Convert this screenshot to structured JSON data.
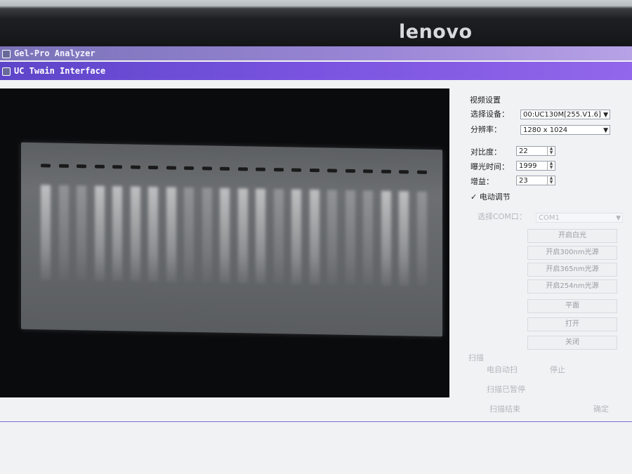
{
  "monitor": {
    "brand": "lenovo"
  },
  "app": {
    "title": "Gel-Pro Analyzer",
    "subtitle": "UC Twain Interface"
  },
  "panel": {
    "group_title": "视频设置",
    "device_label": "选择设备：",
    "device_value": "00:UC130M[255.V1.6]",
    "resolution_label": "分辨率：",
    "resolution_value": "1280 x 1024",
    "contrast_label": "对比度：",
    "contrast_value": "22",
    "exposure_label": "曝光时间：",
    "exposure_value": "1999",
    "gain_label": "增益：",
    "gain_value": "23",
    "auto_adjust_label": "电动调节",
    "auto_adjust_checked": "✓",
    "com_label": "选择COM口：",
    "com_value": "COM1",
    "btn_light": "开启白光",
    "btn_uv300": "开启300nm光源",
    "btn_uv365": "开启365nm光源",
    "btn_uv254": "开启254nm光源",
    "btn_flat": "平面",
    "btn_open": "打开",
    "btn_close": "关闭",
    "section_label": "扫描",
    "auto_label": "电自动扫",
    "auto_value": "停止",
    "scan_status": "扫描已暂停",
    "scan_cancel": "扫描结束",
    "apply": "确定"
  },
  "gel": {
    "lane_count": 22
  }
}
